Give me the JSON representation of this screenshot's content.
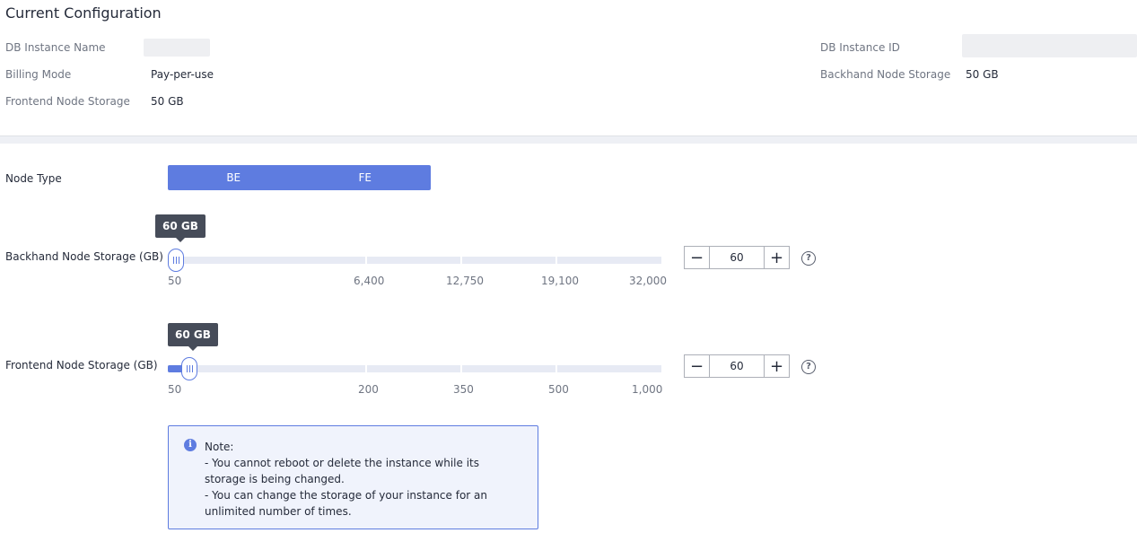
{
  "current_config": {
    "title": "Current Configuration",
    "db_instance_name_label": "DB Instance Name",
    "db_instance_id_label": "DB Instance ID",
    "billing_mode_label": "Billing Mode",
    "billing_mode_value": "Pay-per-use",
    "backhand_storage_label": "Backhand Node Storage",
    "backhand_storage_value": "50 GB",
    "frontend_storage_label": "Frontend Node Storage",
    "frontend_storage_value": "50 GB"
  },
  "node_type": {
    "label": "Node Type",
    "options": [
      "BE",
      "FE"
    ]
  },
  "backhand_slider": {
    "label": "Backhand Node Storage (GB)",
    "tooltip": "60 GB",
    "value": "60",
    "min": 50,
    "max": 32000,
    "ticks": [
      "50",
      "6,400",
      "12,750",
      "19,100",
      "32,000"
    ]
  },
  "frontend_slider": {
    "label": "Frontend Node Storage (GB)",
    "tooltip": "60 GB",
    "value": "60",
    "min": 50,
    "max": 1000,
    "ticks": [
      "50",
      "200",
      "350",
      "500",
      "1,000"
    ]
  },
  "stepper": {
    "minus_icon": "minus-icon",
    "plus_icon": "plus-icon",
    "help_icon": "question-circle-icon"
  },
  "note": {
    "icon": "info-icon",
    "lines": [
      "Note:",
      "- You cannot reboot or delete the instance while its storage is being changed.",
      "- You can change the storage of your instance for an unlimited number of times."
    ]
  },
  "colors": {
    "accent": "#5e7ce0",
    "track": "#e7eaf4",
    "tooltip_bg": "#464c59"
  }
}
